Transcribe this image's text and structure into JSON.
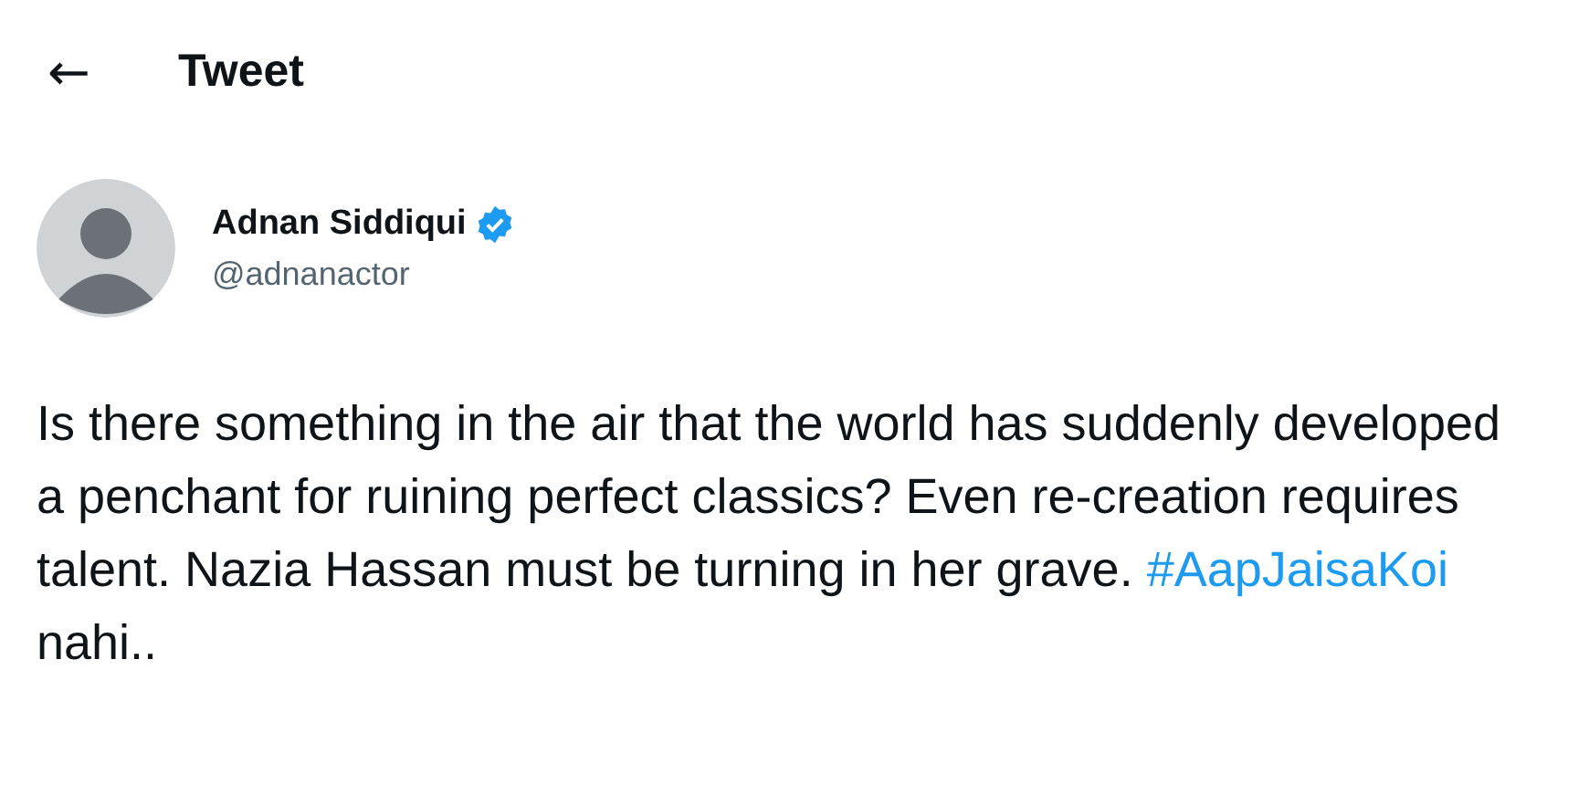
{
  "header": {
    "back": "←",
    "title": "Tweet"
  },
  "author": {
    "name": "Adnan Siddiqui",
    "verified": true,
    "handle": "@adnanactor"
  },
  "tweet": {
    "text": "Is there something in the air that the world has suddenly developed a penchant for ruining perfect classics? Even re-creation requires talent. Nazia Hassan must be turning in her grave.",
    "hashtag": "#AapJaisaKoi",
    "text_after": "nahi.."
  }
}
